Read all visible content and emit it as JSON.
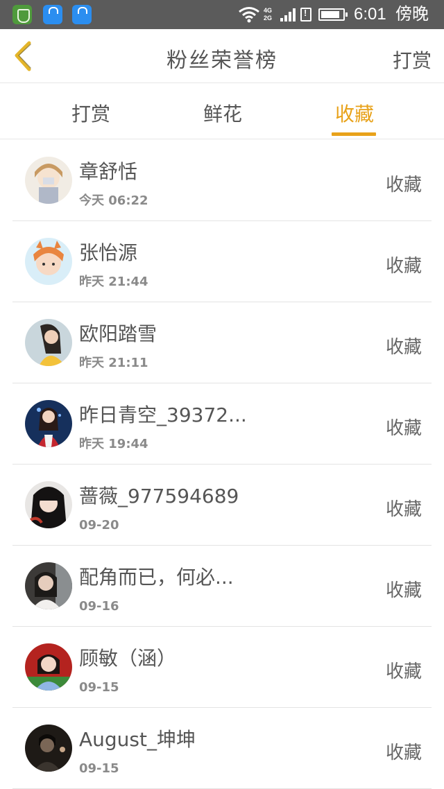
{
  "status_bar": {
    "network_label": "4G\n2G",
    "time": "6:01",
    "period": "傍晚",
    "icons": [
      "shield-app-icon",
      "bag-app-icon",
      "bag-app-icon",
      "wifi-icon",
      "signal-icon",
      "sim-alert-icon",
      "battery-icon"
    ]
  },
  "header": {
    "title": "粉丝荣誉榜",
    "action_label": "打赏",
    "back_icon": "chevron-left-icon"
  },
  "tabs": [
    {
      "label": "打赏",
      "active": false
    },
    {
      "label": "鲜花",
      "active": false
    },
    {
      "label": "收藏",
      "active": true
    }
  ],
  "accent_color": "#e8a21a",
  "rows": [
    {
      "name": "章舒恬",
      "time": "今天 06:22",
      "action": "收藏",
      "avatar": "avatar-girl-cartoon"
    },
    {
      "name": "张怡源",
      "time": "昨天 21:44",
      "action": "收藏",
      "avatar": "avatar-girl-cat-ears"
    },
    {
      "name": "欧阳踏雪",
      "time": "昨天 21:11",
      "action": "收藏",
      "avatar": "avatar-girl-yellow"
    },
    {
      "name": "昨日青空_39372...",
      "time": "昨天 19:44",
      "action": "收藏",
      "avatar": "avatar-girl-blue-bg"
    },
    {
      "name": "蔷薇_977594689",
      "time": "09-20",
      "action": "收藏",
      "avatar": "avatar-girl-dark-hair"
    },
    {
      "name": "配角而已，何必...",
      "time": "09-16",
      "action": "收藏",
      "avatar": "avatar-girl-dark"
    },
    {
      "name": "顾敏（涵）",
      "time": "09-15",
      "action": "收藏",
      "avatar": "avatar-girl-red-bg"
    },
    {
      "name": "August_坤坤",
      "time": "09-15",
      "action": "收藏",
      "avatar": "avatar-boy-dark"
    }
  ]
}
